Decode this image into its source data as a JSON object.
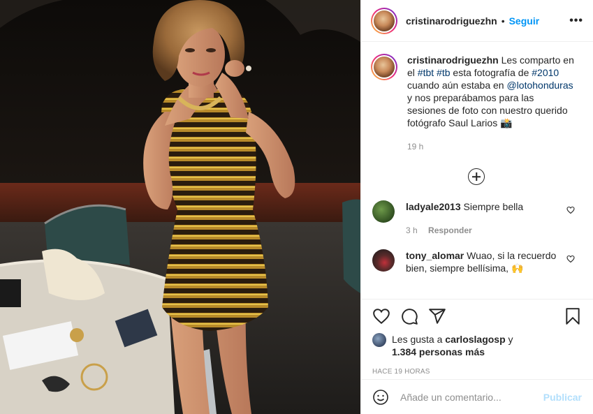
{
  "header": {
    "username": "cristinarodriguezhn",
    "separator": "•",
    "follow_label": "Seguir",
    "more_icon": "more-horizontal-icon"
  },
  "caption": {
    "username": "cristinarodriguezhn",
    "text_1": "Les comparto en el ",
    "tag_1": "#tbt",
    "space_1": " ",
    "tag_2": "#tb",
    "text_2": " esta fotografía de ",
    "tag_3": "#2010",
    "text_3": " cuando aún estaba en ",
    "mention": "@lotohonduras",
    "text_4": " y nos preparábamos para las sesiones de foto con nuestro querido fotógrafo Saul Larios 📸",
    "time": "19 h"
  },
  "comments": [
    {
      "username": "ladyale2013",
      "text": "Siempre bella",
      "time": "3 h",
      "reply_label": "Responder",
      "avatar_color": "#3c6b2a"
    },
    {
      "username": "tony_alomar",
      "text": "Wuao, si la recuerdo bien, siempre bellísima, 🙌",
      "avatar_color": "#5a3b3b"
    }
  ],
  "likes": {
    "prefix": "Les gusta a ",
    "user": "carloslagosp",
    "mid": " y",
    "count": "1.384 personas más"
  },
  "posted_ago": "HACE 19 HORAS",
  "add_comment": {
    "placeholder": "Añade un comentario...",
    "publish_label": "Publicar"
  },
  "colors": {
    "accent": "#0095f6",
    "link": "#00376b",
    "muted": "#8e8e8e",
    "publish_disabled": "#b2dffc"
  }
}
